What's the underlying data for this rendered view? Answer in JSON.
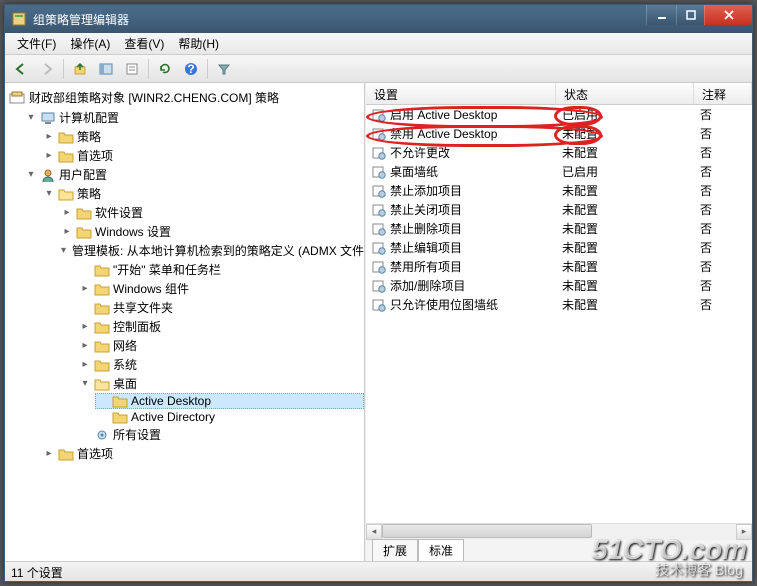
{
  "window": {
    "title": "组策略管理编辑器"
  },
  "menu": {
    "file": "文件(F)",
    "action": "操作(A)",
    "view": "查看(V)",
    "help": "帮助(H)"
  },
  "toolbar_icons": {
    "back": "back-icon",
    "forward": "forward-icon",
    "up": "up-icon",
    "props": "properties-icon",
    "export": "export-icon",
    "refresh": "refresh-icon",
    "help": "help-icon",
    "filter": "filter-icon"
  },
  "tree": {
    "root": "财政部组策略对象 [WINR2.CHENG.COM] 策略",
    "computer_config": "计算机配置",
    "cc_policies": "策略",
    "cc_prefs": "首选项",
    "user_config": "用户配置",
    "uc_policies": "策略",
    "software_settings": "软件设置",
    "windows_settings": "Windows 设置",
    "admin_templates": "管理模板: 从本地计算机检索到的策略定义 (ADMX 文件)。",
    "start_taskbar": "\"开始\" 菜单和任务栏",
    "windows_components": "Windows 组件",
    "shared_folders": "共享文件夹",
    "control_panel": "控制面板",
    "network": "网络",
    "system": "系统",
    "desktop": "桌面",
    "active_desktop": "Active Desktop",
    "active_directory": "Active Directory",
    "all_settings": "所有设置",
    "uc_prefs": "首选项"
  },
  "columns": {
    "setting": "设置",
    "state": "状态",
    "comment": "注释"
  },
  "rows": [
    {
      "name": "启用 Active Desktop",
      "state": "已启用",
      "comment": "否"
    },
    {
      "name": "禁用 Active Desktop",
      "state": "未配置",
      "comment": "否"
    },
    {
      "name": "不允许更改",
      "state": "未配置",
      "comment": "否"
    },
    {
      "name": "桌面墙纸",
      "state": "已启用",
      "comment": "否"
    },
    {
      "name": "禁止添加项目",
      "state": "未配置",
      "comment": "否"
    },
    {
      "name": "禁止关闭项目",
      "state": "未配置",
      "comment": "否"
    },
    {
      "name": "禁止删除项目",
      "state": "未配置",
      "comment": "否"
    },
    {
      "name": "禁止编辑项目",
      "state": "未配置",
      "comment": "否"
    },
    {
      "name": "禁用所有项目",
      "state": "未配置",
      "comment": "否"
    },
    {
      "name": "添加/删除项目",
      "state": "未配置",
      "comment": "否"
    },
    {
      "name": "只允许使用位图墙纸",
      "state": "未配置",
      "comment": "否"
    }
  ],
  "tabs": {
    "extended": "扩展",
    "standard": "标准"
  },
  "status": "11 个设置",
  "watermark": {
    "main": "51CTO.com",
    "sub": "技术博客  Blog"
  }
}
